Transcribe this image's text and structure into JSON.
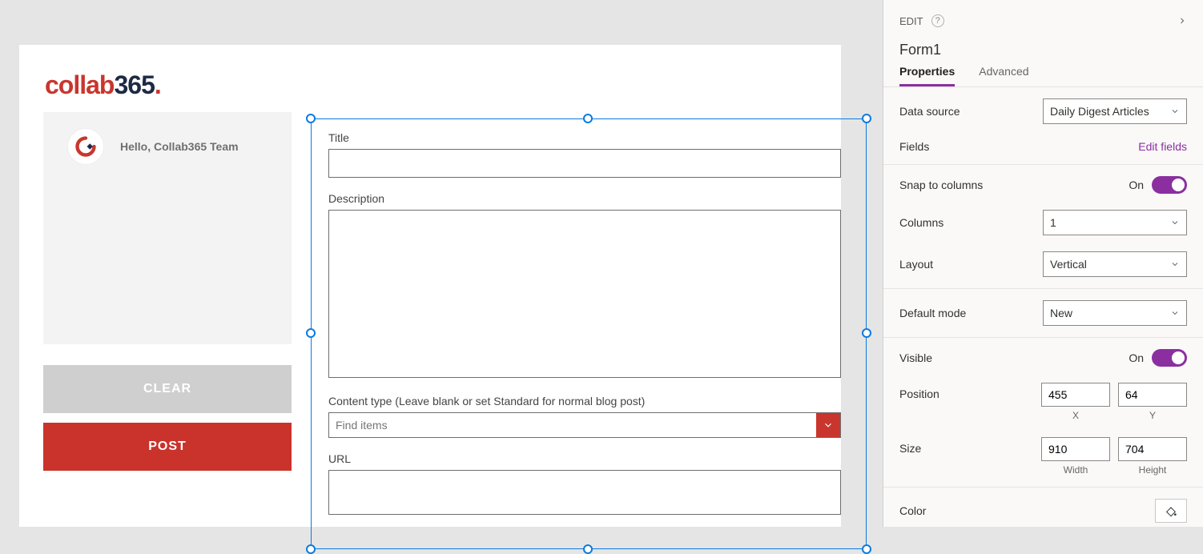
{
  "app": {
    "logo_part1": "collab",
    "logo_part2": "365",
    "greeting": "Hello, Collab365 Team",
    "clear_label": "CLEAR",
    "post_label": "POST"
  },
  "form": {
    "fields": {
      "title": {
        "label": "Title",
        "value": ""
      },
      "description": {
        "label": "Description",
        "value": ""
      },
      "content_type": {
        "label": "Content type (Leave blank or set Standard for normal blog post)",
        "placeholder": "Find items"
      },
      "url": {
        "label": "URL",
        "value": ""
      }
    }
  },
  "pane": {
    "edit_label": "EDIT",
    "object_name": "Form1",
    "tabs": {
      "properties": "Properties",
      "advanced": "Advanced"
    },
    "rows": {
      "data_source": {
        "label": "Data source",
        "value": "Daily Digest Articles"
      },
      "fields": {
        "label": "Fields",
        "link": "Edit fields"
      },
      "snap": {
        "label": "Snap to columns",
        "value": "On"
      },
      "columns": {
        "label": "Columns",
        "value": "1"
      },
      "layout": {
        "label": "Layout",
        "value": "Vertical"
      },
      "default_mode": {
        "label": "Default mode",
        "value": "New"
      },
      "visible": {
        "label": "Visible",
        "value": "On"
      },
      "position": {
        "label": "Position",
        "x": "455",
        "y": "64",
        "x_sub": "X",
        "y_sub": "Y"
      },
      "size": {
        "label": "Size",
        "w": "910",
        "h": "704",
        "w_sub": "Width",
        "h_sub": "Height"
      },
      "color": {
        "label": "Color"
      }
    }
  }
}
